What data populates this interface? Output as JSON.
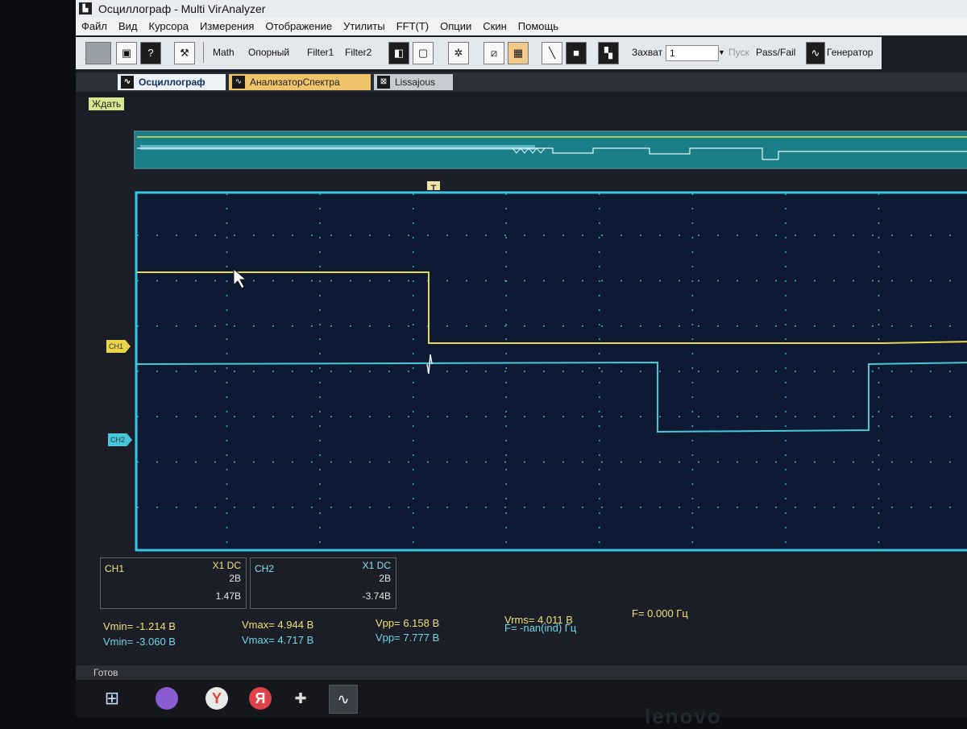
{
  "window": {
    "title": "Осциллограф - Multi VirAnalyzer",
    "icon": "app-icon"
  },
  "menu": [
    "Файл",
    "Вид",
    "Курсора",
    "Измерения",
    "Отображение",
    "Утилиты",
    "FFT(T)",
    "Опции",
    "Скин",
    "Помощь"
  ],
  "toolbar": {
    "math": "Math",
    "ref": "Опорный",
    "filter1": "Filter1",
    "filter2": "Filter2",
    "capture_label": "Захват",
    "capture_value": "1",
    "run": "Пуск",
    "passfail": "Pass/Fail",
    "generator": "Генератор"
  },
  "tabs": [
    {
      "label": "Осциллограф",
      "active": true
    },
    {
      "label": "АнализаторСпектра",
      "active": false
    },
    {
      "label": "Lissajous",
      "active": false
    }
  ],
  "status_wait": "Ждать",
  "trigger_label": "T",
  "ch1": {
    "marker": "CH1",
    "label": "CH1",
    "probe_coupling": "X1  DC",
    "scale": "2В",
    "offset": "1.47В",
    "color": "#e8d84a"
  },
  "ch2": {
    "marker": "CH2",
    "label": "CH2",
    "probe_coupling": "X1  DC",
    "scale": "2В",
    "offset": "-3.74В",
    "color": "#45c8dc"
  },
  "measurements": {
    "ch1": {
      "vmin": "Vmin= -1.214 В",
      "vmax": "Vmax= 4.944 В",
      "vpp": "Vpp= 6.158 В",
      "vrms": "Vrms= 4.011 В",
      "freq": "F= 0.000 Гц"
    },
    "ch2": {
      "vmin": "Vmin= -3.060 В",
      "vmax": "Vmax= 4.717 В",
      "vpp": "Vpp= 7.777 В",
      "freq": "F= -nan(ind) Гц"
    }
  },
  "statusbar": "Готов",
  "taskbar": [
    "windows-start-icon",
    "alice-icon",
    "yandex-browser-icon",
    "yandex-icon",
    "app-icon",
    "oscilloscope-app-icon"
  ],
  "bezel_logo": "lenovo"
}
